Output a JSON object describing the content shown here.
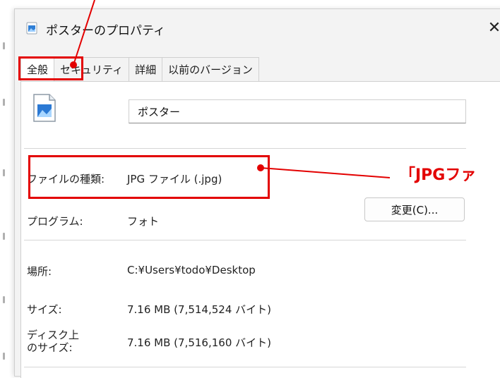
{
  "window": {
    "title": "ポスターのプロパティ",
    "close_symbol": "✕"
  },
  "tabs": [
    {
      "label": "全般",
      "active": true
    },
    {
      "label": "セキュリティ",
      "active": false
    },
    {
      "label": "詳細",
      "active": false
    },
    {
      "label": "以前のバージョン",
      "active": false
    }
  ],
  "general": {
    "file_name": "ポスター",
    "file_icon": "image-file-icon",
    "file_type_label": "ファイルの種類:",
    "file_type_value": "JPG ファイル (.jpg)",
    "program_label": "プログラム:",
    "program_value": "フォト",
    "change_button": "変更(C)...",
    "location_label": "場所:",
    "location_value": "C:¥Users¥todo¥Desktop",
    "size_label": "サイズ:",
    "size_value": "7.16 MB (7,514,524 バイト)",
    "disk_size_label_line1": "ディスク上",
    "disk_size_label_line2": "のサイズ:",
    "disk_size_value": "7.16 MB (7,516,160 バイト)"
  },
  "annotation": {
    "callout_text": "「JPGファ",
    "color": "#e30000"
  }
}
